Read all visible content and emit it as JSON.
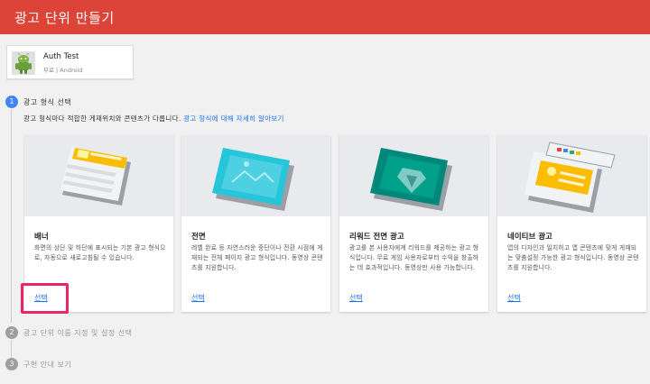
{
  "header": {
    "title": "광고 단위 만들기",
    "color": "#db4437"
  },
  "app": {
    "name": "Auth Test",
    "meta": "무료 | Android",
    "icon": "android-app-icon"
  },
  "steps": [
    {
      "number": "1",
      "title": "광고 형식 선택",
      "state": "active"
    },
    {
      "number": "2",
      "title": "광고 단위 이름 지정 및 설정 선택",
      "state": "inactive"
    },
    {
      "number": "3",
      "title": "구현 안내 보기",
      "state": "inactive"
    }
  ],
  "step1": {
    "description": "광고 형식마다 적합한 게재위치와 콘텐츠가 다릅니다.",
    "link": "광고 형식에 대해 자세히 알아보기"
  },
  "cards": [
    {
      "title": "배너",
      "desc": "화면의 상단 및 하단에 표시되는 기본 광고 형식으로, 자동으로 새로고침될 수 있습니다.",
      "select": "선택",
      "illustration": "banner-illustration"
    },
    {
      "title": "전면",
      "desc": "레벨 완료 등 자연스러운 중단이나 전환 시점에 게재되는 전체 페이지 광고 형식입니다. 동영상 콘텐츠를 지원합니다.",
      "select": "선택",
      "illustration": "interstitial-illustration"
    },
    {
      "title": "리워드 전면 광고",
      "desc": "광고를 본 사용자에게 리워드를 제공하는 광고 형식입니다. 무료 게임 사용자로부터 수익을 창출하는 데 효과적입니다. 동영상만 사용 가능합니다.",
      "select": "선택",
      "illustration": "rewarded-illustration"
    },
    {
      "title": "네이티브 광고",
      "desc": "앱의 디자인과 일치하고 앱 콘텐츠에 맞게 게재되는 맞춤설정 가능한 광고 형식입니다. 동영상 콘텐츠를 지원합니다.",
      "select": "선택",
      "illustration": "native-illustration"
    }
  ],
  "colors": {
    "accent": "#4285f4",
    "link": "#1a73e8",
    "highlight": "#e9266a"
  }
}
